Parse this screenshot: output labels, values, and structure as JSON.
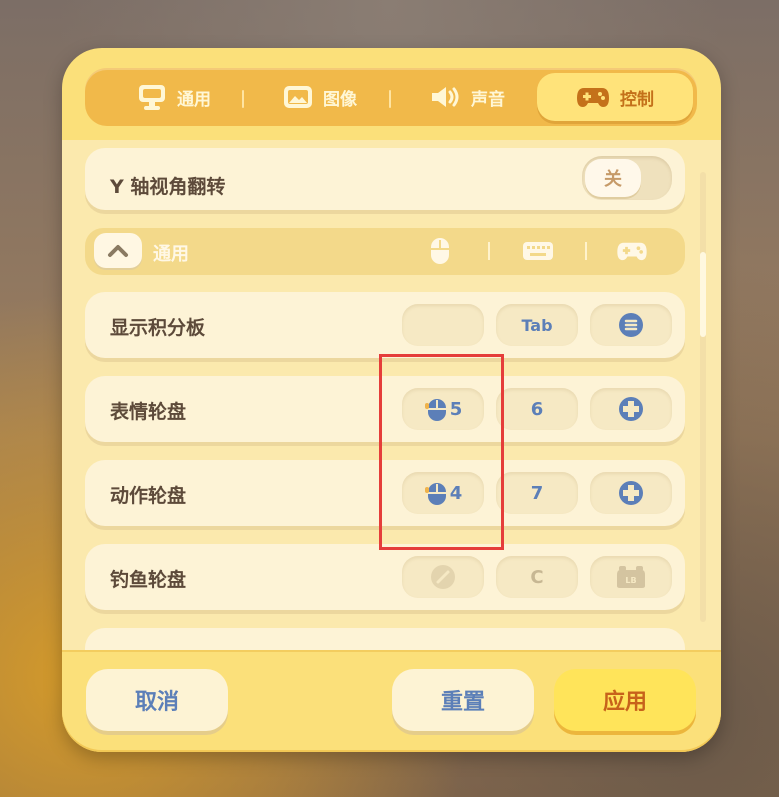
{
  "tabs": [
    {
      "label": "通用",
      "icon": "monitor-icon"
    },
    {
      "label": "图像",
      "icon": "image-icon"
    },
    {
      "label": "声音",
      "icon": "speaker-icon"
    },
    {
      "label": "控制",
      "icon": "gamepad-icon",
      "active": true
    }
  ],
  "invert_y": {
    "label": "Y 轴视角翻转",
    "toggle": "关"
  },
  "section": {
    "label": "通用",
    "columns": [
      "mouse-icon",
      "keyboard-icon",
      "gamepad-icon"
    ]
  },
  "bindings": [
    {
      "label": "显示积分板",
      "mouse": "",
      "keyboard": "Tab",
      "gamepad": "menu-button-icon"
    },
    {
      "label": "表情轮盘",
      "mouse": "5",
      "keyboard": "6",
      "gamepad": "dpad-icon"
    },
    {
      "label": "动作轮盘",
      "mouse": "4",
      "keyboard": "7",
      "gamepad": "dpad-icon"
    },
    {
      "label": "钓鱼轮盘",
      "mouse": "disabled-icon",
      "keyboard": "C",
      "gamepad": "lb-button-icon"
    }
  ],
  "footer": {
    "cancel": "取消",
    "reset": "重置",
    "apply": "应用"
  },
  "colors": {
    "accent": "#fbe07a",
    "active_tab_text": "#c4711a",
    "key_text": "#5c7fb8",
    "highlight": "#e53d3a"
  }
}
